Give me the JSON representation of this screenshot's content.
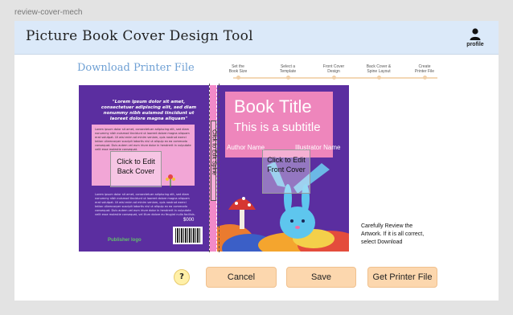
{
  "frame": {
    "label": "review-cover-mech"
  },
  "header": {
    "title": "Picture Book Cover Design Tool",
    "profile_label": "profile"
  },
  "page": {
    "subtitle": "Download Printer File"
  },
  "steps": [
    {
      "label": "Set the\nBook Size"
    },
    {
      "label": "Select a\nTemplate"
    },
    {
      "label": "Front Cover\nDesign"
    },
    {
      "label": "Back Cover &\nSpine Layout"
    },
    {
      "label": "Create\nPrinter File"
    }
  ],
  "cover": {
    "back_quote": "\"Lorem ipsum dolor sit amet, consectetuer adipiscing elit, sed diam nonummy nibh euismod tincidunt ut laoreet dolore magna aliquam\"",
    "back_lorem": "Lorem ipsum dolor sit amet, consectetuer adipiscing elit, sed diam nonummy nibh euismod tincidunt ut laoreet dolore magna aliquam erat volutpat. Ut wisi enim ad minim veniam, quis nostrud exerci tation ullamcorper suscipit lobortis nisl ut aliquip ex ea commodo consequat. Duis autem vel eum iriure dolor in hendrerit in vulputate velit esse molestie consequat.",
    "back_body": "Lorem ipsum dolor sit amet, consectetuer adipiscing elit, sed diam nonummy nibh euismod tincidunt ut laoreet dolore magna aliquam erat volutpat. Ut wisi enim ad minim veniam, quis nostrud exerci tation ullamcorper suscipit lobortis nisl ut aliquip ex ea commodo consequat. Duis autem vel eum iriure dolor in hendrerit in vulputate velit esse molestie consequat, vel illum dolore eu feugiat nulla facilisis.",
    "price": "$000",
    "publisher": "Publisher logo",
    "edit_back": "Click to Edit Back Cover",
    "spine_label": "Click to Edit Spine",
    "front_title": "Book Title",
    "front_subtitle": "This is a subtitle",
    "author": "Author Name",
    "illustrator": "Illustrator Name",
    "edit_front": "Click to Edit Front Cover"
  },
  "review_note": "Carefully Review the Artwork. If it is all correct, select Download",
  "buttons": {
    "help": "?",
    "cancel": "Cancel",
    "save": "Save",
    "get_printer_file": "Get Printer File"
  },
  "colors": {
    "header_bg": "#dbe9f9",
    "cover_purple": "#5b2ea0",
    "cover_pink": "#ee86bc",
    "button": "#fcd7ae"
  }
}
